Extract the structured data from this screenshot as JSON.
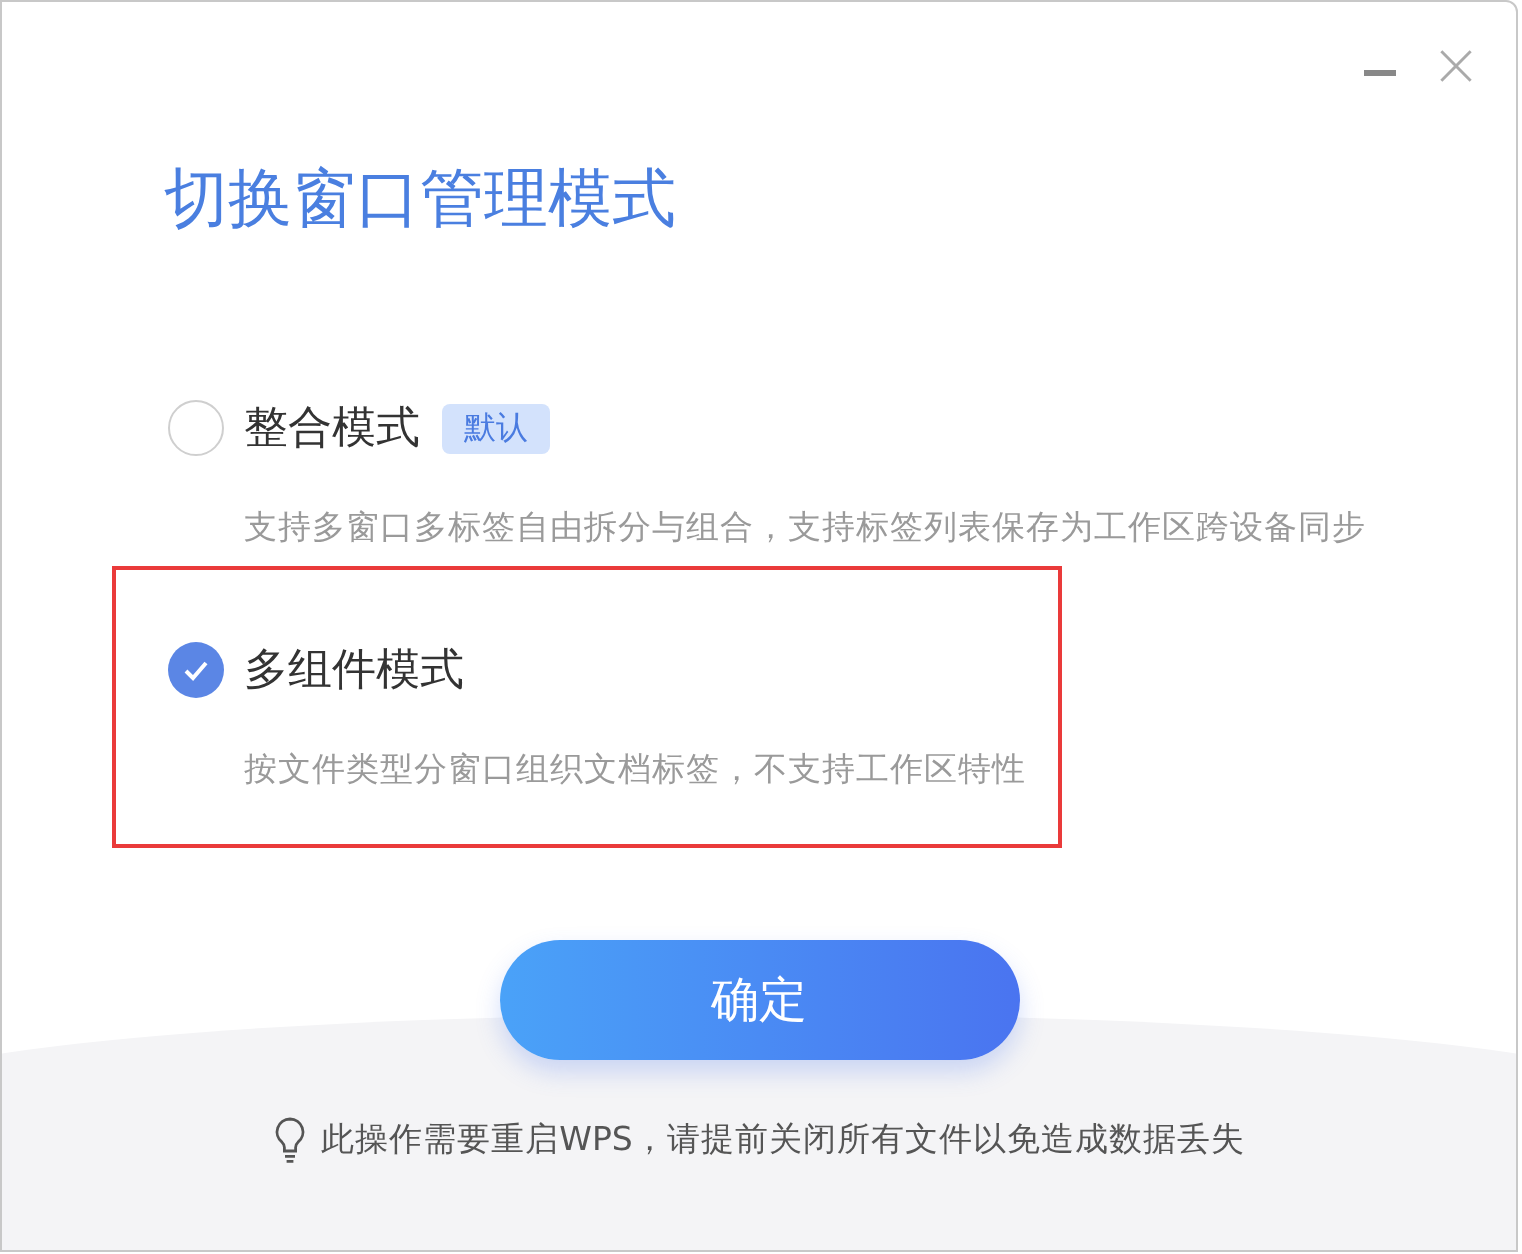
{
  "window": {
    "controls": [
      {
        "kind": "minimize"
      },
      {
        "kind": "close"
      }
    ]
  },
  "title": "切换窗口管理模式",
  "options": [
    {
      "label": "整合模式",
      "badge": "默认",
      "description": "支持多窗口多标签自由拆分与组合，支持标签列表保存为工作区跨设备同步",
      "selected": false,
      "highlighted": false
    },
    {
      "label": "多组件模式",
      "description": "按文件类型分窗口组织文档标签，不支持工作区特性",
      "selected": true,
      "highlighted": true
    }
  ],
  "confirm_button": "确定",
  "hint": "此操作需要重启WPS，请提前关闭所有文件以免造成数据丢失"
}
